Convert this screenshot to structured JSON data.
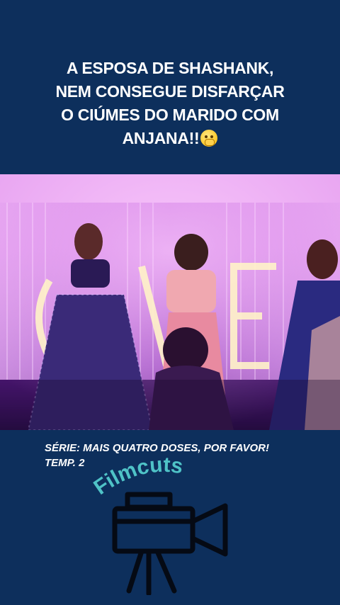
{
  "headline": {
    "line1": "A ESPOSA DE SHASHANK,",
    "line2": "NEM CONSEGUE DISFARÇAR",
    "line3": "O CIÚMES DO MARIDO COM",
    "line4": "ANJANA!!"
  },
  "emoji_icon": "shushing-face-icon",
  "caption": {
    "line1": "SÉRIE: MAIS QUATRO DOSES, POR FAVOR!",
    "line2": "TEMP. 2"
  },
  "logo": {
    "text": "Filmcuts",
    "color": "#4fc3c7",
    "icon": "video-camera-icon"
  },
  "colors": {
    "background": "#0d2f5c",
    "text": "#ffffff"
  }
}
